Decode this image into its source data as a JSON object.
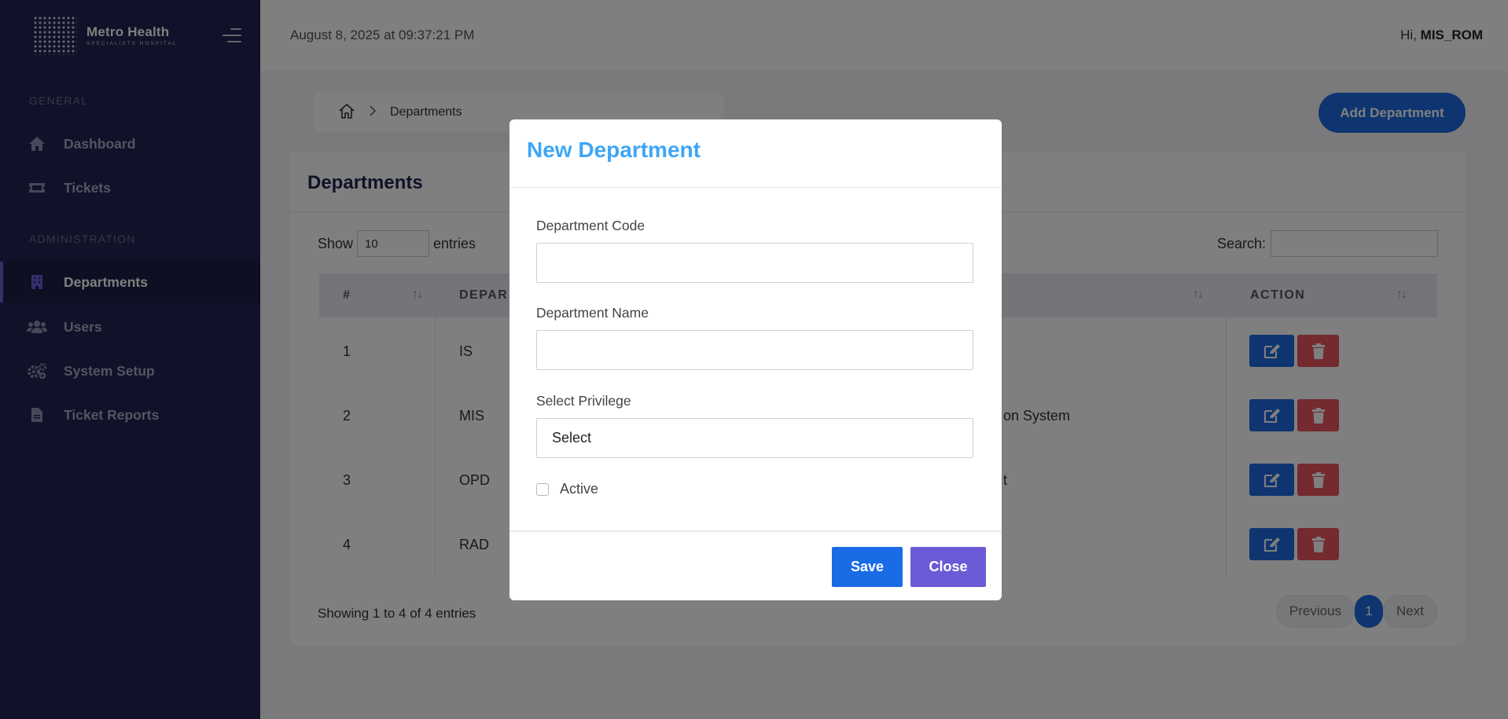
{
  "app": {
    "logo_line1": "Metro Health",
    "logo_line2": "SPECIALISTS HOSPITAL"
  },
  "sidebar": {
    "section_general": "GENERAL",
    "section_admin": "ADMINISTRATION",
    "items": [
      {
        "label": "Dashboard",
        "icon": "home-icon"
      },
      {
        "label": "Tickets",
        "icon": "ticket-icon"
      },
      {
        "label": "Departments",
        "icon": "building-icon",
        "active": true
      },
      {
        "label": "Users",
        "icon": "users-icon"
      },
      {
        "label": "System Setup",
        "icon": "gears-icon"
      },
      {
        "label": "Ticket Reports",
        "icon": "document-icon"
      }
    ]
  },
  "topbar": {
    "datetime": "August 8, 2025 at 09:37:21 PM",
    "greeting": "Hi,",
    "username": "MIS_ROM"
  },
  "breadcrumb": {
    "current": "Departments"
  },
  "add_button_label": "Add Department",
  "card": {
    "title": "Departments",
    "show_label": "Show",
    "page_length": "10",
    "entries_label": "entries",
    "search_label": "Search:",
    "search_value": "",
    "columns": [
      "#",
      "DEPAR",
      "ACTION"
    ],
    "rows": [
      {
        "num": "1",
        "code": "IS",
        "name_fragment": ""
      },
      {
        "num": "2",
        "code": "MIS",
        "name_fragment": "on System"
      },
      {
        "num": "3",
        "code": "OPD",
        "name_fragment": "t"
      },
      {
        "num": "4",
        "code": "RAD",
        "name_fragment": ""
      }
    ],
    "info": "Showing 1 to 4 of 4 entries",
    "pager": {
      "previous": "Previous",
      "page": "1",
      "next": "Next"
    }
  },
  "modal": {
    "title": "New Department",
    "code_label": "Department Code",
    "code_value": "",
    "name_label": "Department Name",
    "name_value": "",
    "privilege_label": "Select Privilege",
    "privilege_value": "Select",
    "active_label": "Active",
    "active_checked": false,
    "save_label": "Save",
    "close_label": "Close"
  },
  "colors": {
    "sidebar_bg": "#1f2550",
    "primary": "#1f6be0",
    "danger": "#e8545e",
    "accent_purple": "#6c5bd6",
    "modal_title": "#3ea6f5"
  }
}
